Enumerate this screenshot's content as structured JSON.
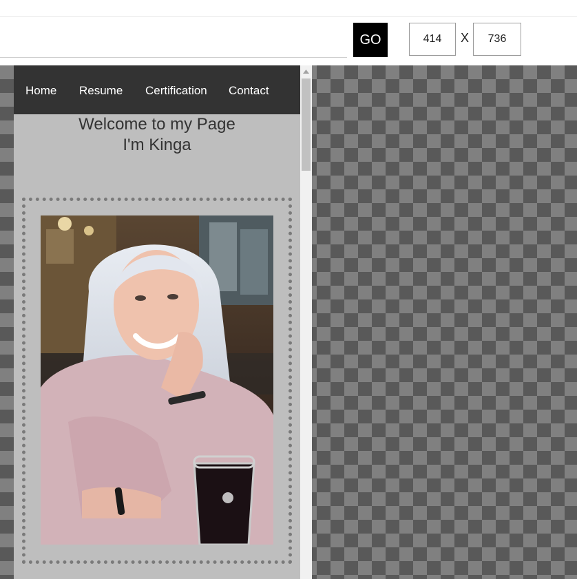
{
  "toolbar": {
    "url_value": "",
    "go_label": "GO",
    "width_value": "414",
    "height_value": "736",
    "separator": "X"
  },
  "site": {
    "nav": [
      "Home",
      "Resume",
      "Certification",
      "Contact"
    ],
    "welcome_line1": "Welcome to my Page",
    "welcome_line2": "I'm Kinga",
    "nav_bg": "#333333",
    "page_bg": "#bebebe"
  },
  "icons": {
    "scroll_up": "triangle-up-icon"
  }
}
